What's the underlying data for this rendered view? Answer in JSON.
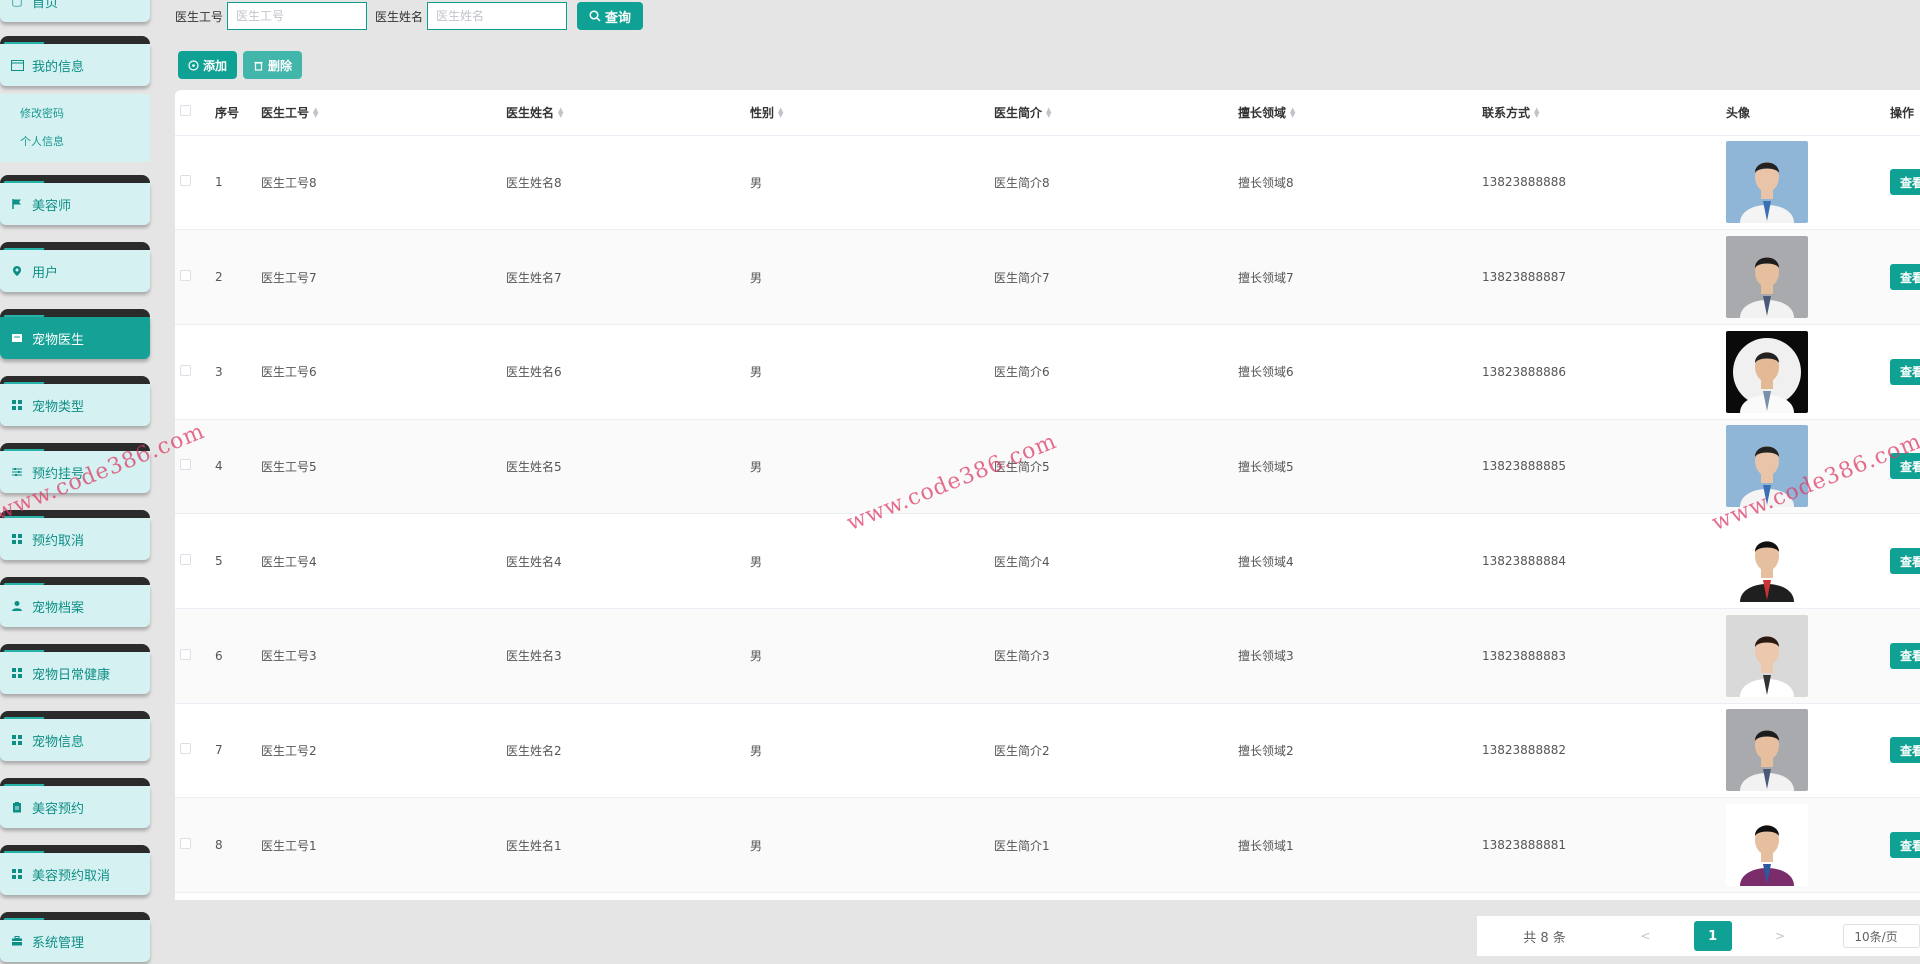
{
  "sidebar": {
    "home": "首页",
    "my_info": "我的信息",
    "sub_items": [
      "修改密码",
      "个人信息"
    ],
    "items": [
      {
        "label": "美容师",
        "icon": "flag-icon"
      },
      {
        "label": "用户",
        "icon": "location-pin-icon"
      },
      {
        "label": "宠物医生",
        "icon": "card-icon",
        "active": true
      },
      {
        "label": "宠物类型",
        "icon": "grid-icon"
      },
      {
        "label": "预约挂号",
        "icon": "sliders-icon"
      },
      {
        "label": "预约取消",
        "icon": "grid-icon"
      },
      {
        "label": "宠物档案",
        "icon": "user-icon"
      },
      {
        "label": "宠物日常健康",
        "icon": "grid-icon"
      },
      {
        "label": "宠物信息",
        "icon": "grid-icon"
      },
      {
        "label": "美容预约",
        "icon": "clipboard-icon"
      },
      {
        "label": "美容预约取消",
        "icon": "grid-icon"
      },
      {
        "label": "系统管理",
        "icon": "briefcase-icon"
      }
    ]
  },
  "search": {
    "doctor_id_label": "医生工号",
    "doctor_id_placeholder": "医生工号",
    "doctor_name_label": "医生姓名",
    "doctor_name_placeholder": "医生姓名",
    "query_label": "查询"
  },
  "actions": {
    "add_label": "添加",
    "delete_label": "删除"
  },
  "table": {
    "headers": [
      "序号",
      "医生工号",
      "医生姓名",
      "性别",
      "医生简介",
      "擅长领域",
      "联系方式",
      "头像",
      "操作"
    ],
    "view_label": "查看",
    "rows": [
      {
        "index": "1",
        "doctor_id": "医生工号8",
        "name": "医生姓名8",
        "gender": "男",
        "intro": "医生简介8",
        "field": "擅长领域8",
        "phone": "13823888888"
      },
      {
        "index": "2",
        "doctor_id": "医生工号7",
        "name": "医生姓名7",
        "gender": "男",
        "intro": "医生简介7",
        "field": "擅长领域7",
        "phone": "13823888887"
      },
      {
        "index": "3",
        "doctor_id": "医生工号6",
        "name": "医生姓名6",
        "gender": "男",
        "intro": "医生简介6",
        "field": "擅长领域6",
        "phone": "13823888886"
      },
      {
        "index": "4",
        "doctor_id": "医生工号5",
        "name": "医生姓名5",
        "gender": "男",
        "intro": "医生简介5",
        "field": "擅长领域5",
        "phone": "13823888885"
      },
      {
        "index": "5",
        "doctor_id": "医生工号4",
        "name": "医生姓名4",
        "gender": "男",
        "intro": "医生简介4",
        "field": "擅长领域4",
        "phone": "13823888884"
      },
      {
        "index": "6",
        "doctor_id": "医生工号3",
        "name": "医生姓名3",
        "gender": "男",
        "intro": "医生简介3",
        "field": "擅长领域3",
        "phone": "13823888883"
      },
      {
        "index": "7",
        "doctor_id": "医生工号2",
        "name": "医生姓名2",
        "gender": "男",
        "intro": "医生简介2",
        "field": "擅长领域2",
        "phone": "13823888882"
      },
      {
        "index": "8",
        "doctor_id": "医生工号1",
        "name": "医生姓名1",
        "gender": "男",
        "intro": "医生简介1",
        "field": "擅长领域1",
        "phone": "13823888881"
      }
    ]
  },
  "pagination": {
    "total": "共 8 条",
    "prev": "<",
    "current": "1",
    "next": ">",
    "page_size": "10条/页"
  },
  "watermark": "www.code386.com",
  "colors": {
    "accent": "#0fa294",
    "sidebar_item_bg": "#d6f1f2",
    "sidebar_active_bg": "#15a196",
    "watermark": "#dc3c64"
  }
}
